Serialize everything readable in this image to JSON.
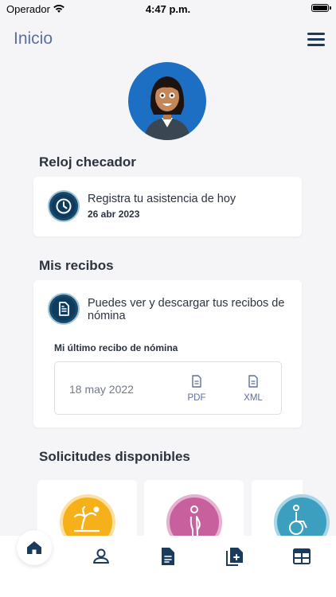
{
  "status_bar": {
    "carrier": "Operador",
    "time": "4:47 p.m."
  },
  "header": {
    "title": "Inicio"
  },
  "clock": {
    "section_title": "Reloj checador",
    "text": "Registra tu asistencia de hoy",
    "date": "26 abr 2023"
  },
  "receipts": {
    "section_title": "Mis recibos",
    "text": "Puedes ver y descargar tus recibos de nómina",
    "last_label": "Mi último recibo de nómina",
    "last_date": "18 may 2022",
    "pdf_label": "PDF",
    "xml_label": "XML"
  },
  "requests": {
    "section_title": "Solicitudes disponibles",
    "items": [
      {
        "icon": "vacation-icon",
        "color": "#f6b019"
      },
      {
        "icon": "maternity-icon",
        "color": "#c8609d"
      },
      {
        "icon": "disability-icon",
        "color": "#3d9fbf"
      }
    ]
  },
  "tabbar": {
    "items": [
      "home-icon",
      "profile-icon",
      "document-icon",
      "add-document-icon",
      "calendar-icon"
    ]
  },
  "colors": {
    "primary": "#1a3b5c",
    "accent": "#5d6ea0",
    "avatar_bg": "#1d6fc4"
  }
}
